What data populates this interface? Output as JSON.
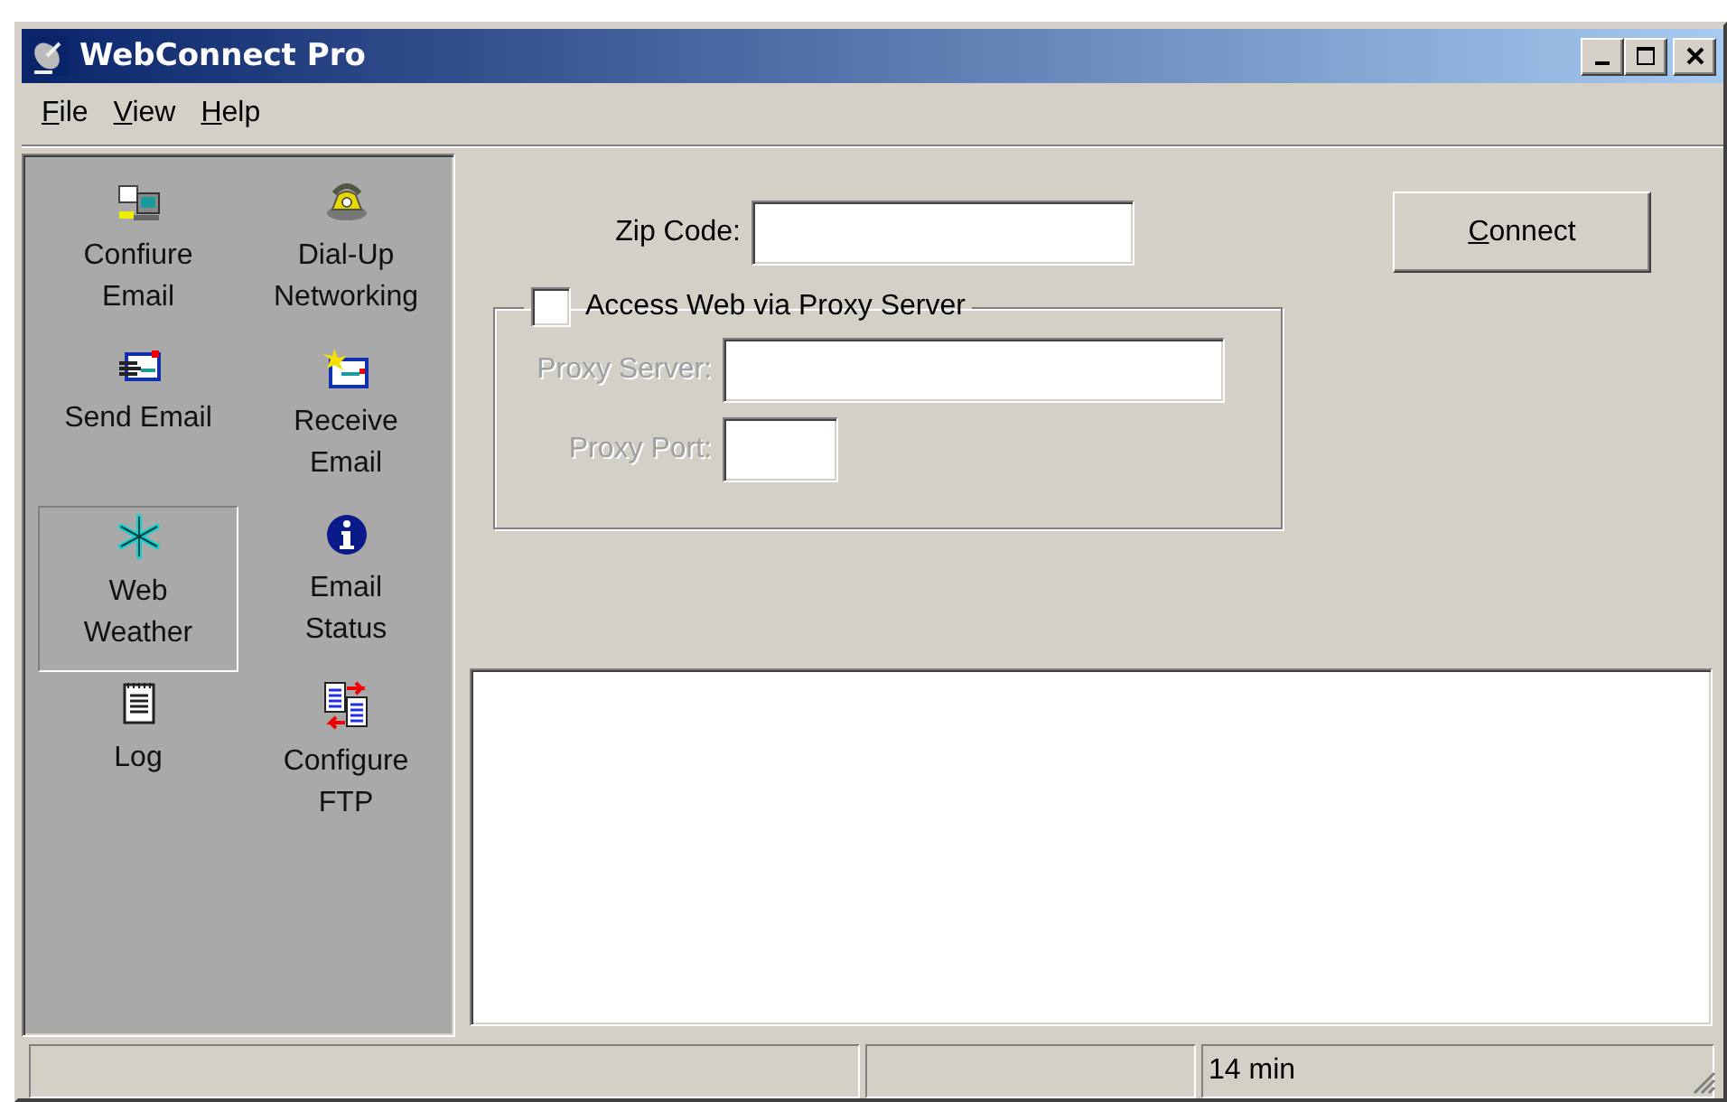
{
  "window": {
    "title": "WebConnect Pro"
  },
  "menu": [
    "File",
    "View",
    "Help"
  ],
  "sidebar": {
    "items": [
      {
        "label": "Confiure\nEmail",
        "selected": false
      },
      {
        "label": "Dial-Up\nNetworking",
        "selected": false
      },
      {
        "label": "Send Email",
        "selected": false
      },
      {
        "label": "Receive\nEmail",
        "selected": false
      },
      {
        "label": "Web\nWeather",
        "selected": true
      },
      {
        "label": "Email\nStatus",
        "selected": false
      },
      {
        "label": "Log",
        "selected": false
      },
      {
        "label": "Configure\nFTP",
        "selected": false
      }
    ]
  },
  "form": {
    "zip_code": {
      "label": "Zip Code:",
      "disabled": false
    },
    "proxy_checkbox": {
      "label": "Access Web via Proxy Server",
      "checked": false
    },
    "proxy_server": {
      "label": "Proxy Server:",
      "disabled": true
    },
    "proxy_port": {
      "label": "Proxy Port:",
      "disabled": true
    },
    "connect_button": "Connect"
  },
  "status_bar": {
    "text": "14 min"
  }
}
